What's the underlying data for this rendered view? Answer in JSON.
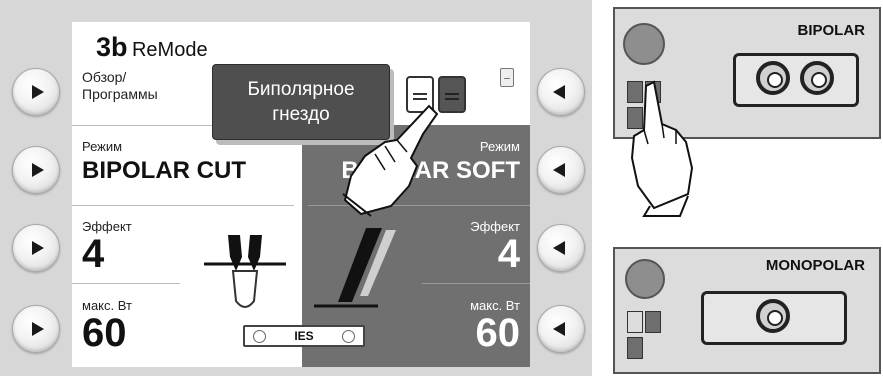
{
  "header": {
    "title_number": "3b",
    "title_text": "ReMode"
  },
  "overview": {
    "line1": "Обзор/",
    "line2": "Программы"
  },
  "popup": {
    "line1": "Биполярное",
    "line2": "гнездо"
  },
  "left_channel": {
    "mode_label": "Режим",
    "mode_value": "BIPOLAR CUT",
    "effect_label": "Эффект",
    "effect_value": "4",
    "power_label": "макс. Вт",
    "power_value": "60"
  },
  "right_channel": {
    "mode_label": "Режим",
    "mode_value": "BIPOLAR SOFT",
    "effect_label": "Эффект",
    "effect_value": "4",
    "power_label": "макс. Вт",
    "power_value": "60"
  },
  "ies_label": "IES",
  "bipolar_panel": {
    "label": "BIPOLAR"
  },
  "monopolar_panel": {
    "label": "MONOPOLAR"
  },
  "icons": {
    "side_button_left": "play-right-icon",
    "side_button_right": "play-left-icon",
    "instrument": "electrode-icon",
    "hand": "pointing-hand-icon"
  },
  "colors": {
    "frame": "#d7d7d7",
    "screen": "#ffffff",
    "dark_panel": "#707070",
    "popup": "#4f4f4f"
  }
}
